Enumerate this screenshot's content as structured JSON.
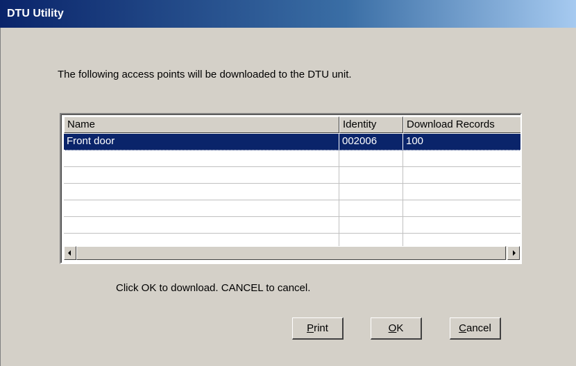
{
  "window": {
    "title": "DTU Utility"
  },
  "instruction": "The following access points will be downloaded to the DTU unit.",
  "table": {
    "columns": [
      "Name",
      "Identity",
      "Download Records"
    ],
    "rows": [
      {
        "name": "Front door",
        "identity": "002006",
        "records": "100",
        "selected": true
      }
    ],
    "empty_rows": 6
  },
  "footer_text": "Click OK to download. CANCEL to cancel.",
  "buttons": {
    "print": {
      "mnemonic": "P",
      "rest": "rint"
    },
    "ok": {
      "mnemonic": "O",
      "rest": "K"
    },
    "cancel": {
      "mnemonic": "C",
      "rest": "ancel"
    }
  },
  "colors": {
    "titlebar_start": "#0a246a",
    "titlebar_end": "#a6caf0",
    "selection": "#0a246a",
    "dialog_bg": "#d4d0c8"
  }
}
